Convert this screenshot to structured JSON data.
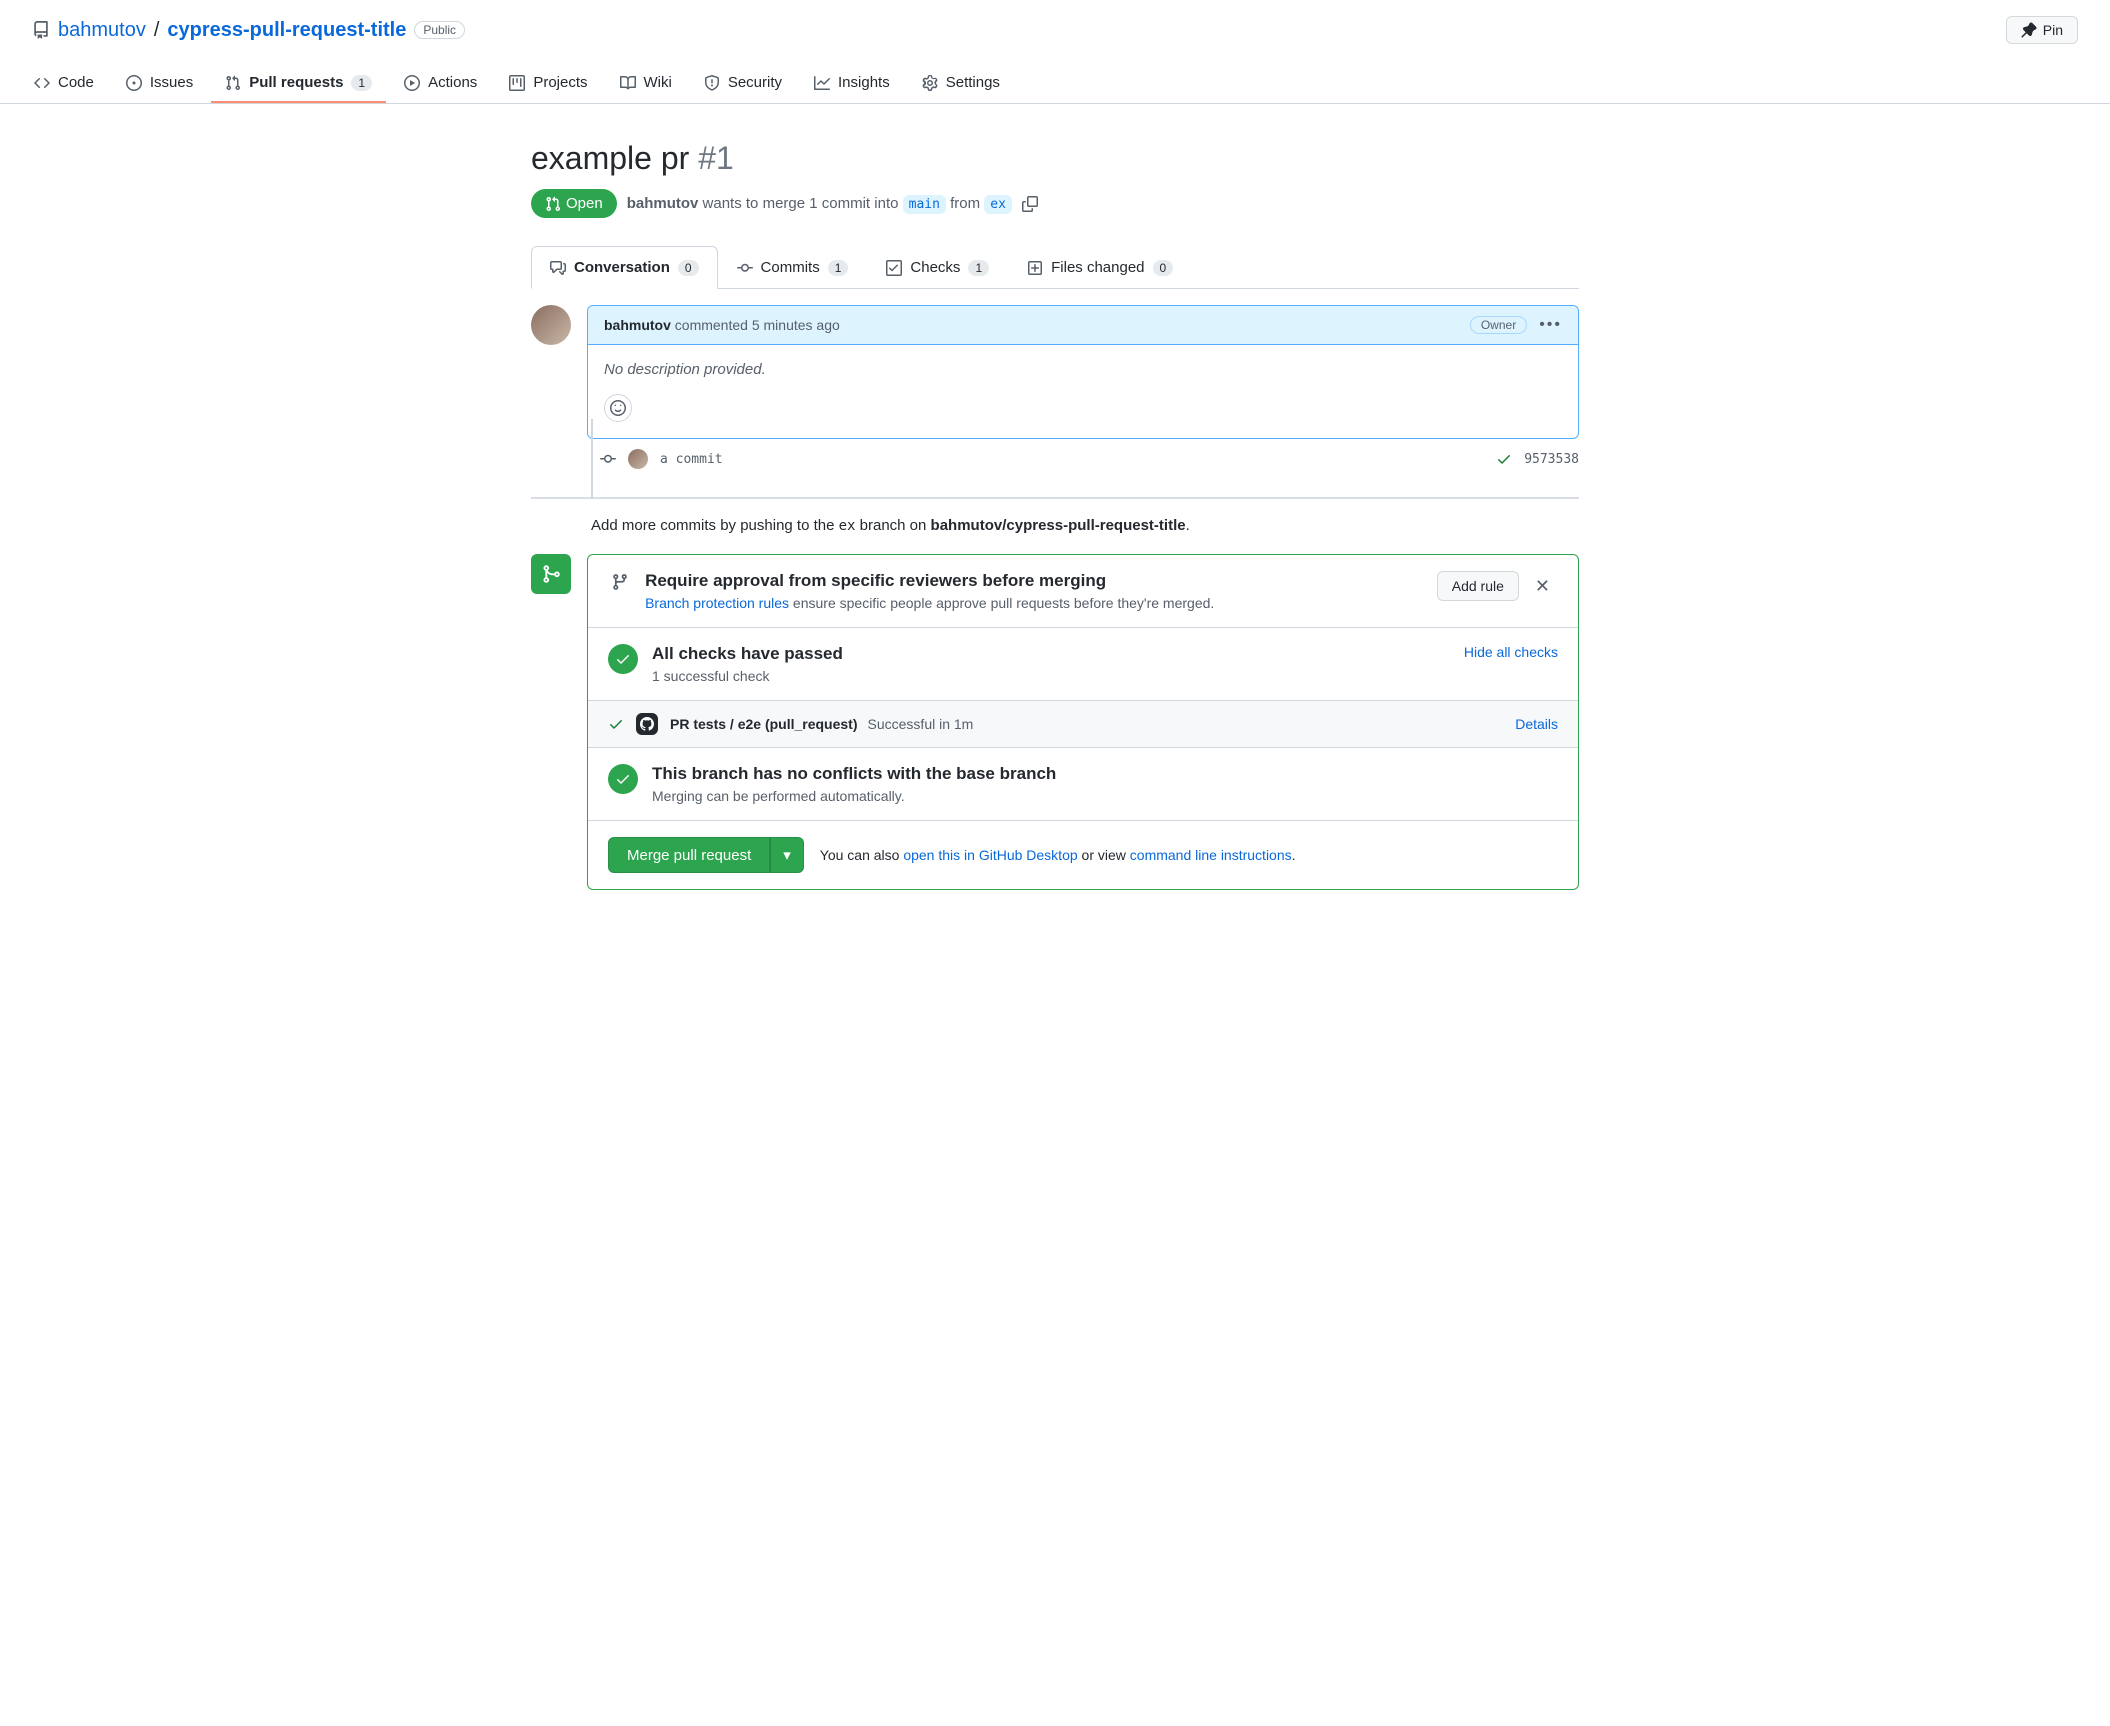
{
  "repo": {
    "owner": "bahmutov",
    "name": "cypress-pull-request-title",
    "visibility": "Public",
    "pin_label": "Pin"
  },
  "nav": {
    "code": "Code",
    "issues": "Issues",
    "pull_requests": "Pull requests",
    "pull_requests_count": "1",
    "actions": "Actions",
    "projects": "Projects",
    "wiki": "Wiki",
    "security": "Security",
    "insights": "Insights",
    "settings": "Settings"
  },
  "pr": {
    "title": "example pr",
    "number": "#1",
    "state": "Open",
    "author": "bahmutov",
    "wants_to_merge": " wants to merge 1 commit into ",
    "base_branch": "main",
    "from_text": " from ",
    "head_branch": "ex"
  },
  "tabs": {
    "conversation": "Conversation",
    "conversation_count": "0",
    "commits": "Commits",
    "commits_count": "1",
    "checks": "Checks",
    "checks_count": "1",
    "files": "Files changed",
    "files_count": "0"
  },
  "comment": {
    "author": "bahmutov",
    "time_prefix": " commented ",
    "time": "5 minutes ago",
    "owner_label": "Owner",
    "body": "No description provided."
  },
  "commit": {
    "message": "a commit",
    "sha": "9573538"
  },
  "push_hint": {
    "prefix": "Add more commits by pushing to the ",
    "branch": "ex",
    "middle": " branch on ",
    "target": "bahmutov/cypress-pull-request-title",
    "suffix": "."
  },
  "protection": {
    "title": "Require approval from specific reviewers before merging",
    "link": "Branch protection rules",
    "rest": " ensure specific people approve pull requests before they're merged.",
    "add_rule": "Add rule"
  },
  "checks": {
    "title": "All checks have passed",
    "subtitle": "1 successful check",
    "hide_link": "Hide all checks",
    "run_name": "PR tests / e2e (pull_request)",
    "run_status": "Successful in 1m",
    "details": "Details"
  },
  "conflicts": {
    "title": "This branch has no conflicts with the base branch",
    "subtitle": "Merging can be performed automatically."
  },
  "merge": {
    "button": "Merge pull request",
    "also_prefix": "You can also ",
    "desktop_link": "open this in GitHub Desktop",
    "or_view": " or view ",
    "cli_link": "command line instructions",
    "suffix": "."
  }
}
